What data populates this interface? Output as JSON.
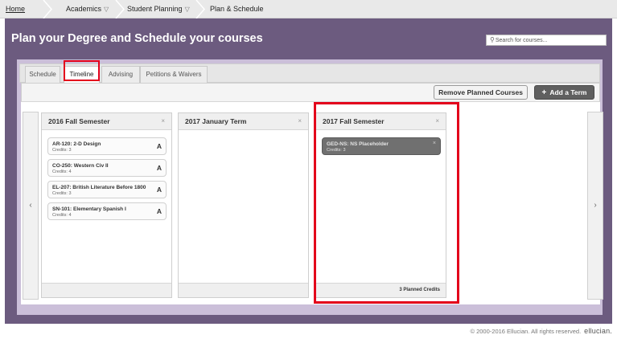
{
  "breadcrumb": {
    "home": "Home",
    "academics": "Academics",
    "student_planning": "Student Planning",
    "current": "Plan & Schedule"
  },
  "header": {
    "title": "Plan your Degree and Schedule your courses",
    "search_placeholder": "Search for courses..."
  },
  "tabs": [
    {
      "label": "Schedule"
    },
    {
      "label": "Timeline"
    },
    {
      "label": "Advising"
    },
    {
      "label": "Petitions & Waivers"
    }
  ],
  "toolbar": {
    "remove_label": "Remove Planned Courses",
    "add_label": "Add a Term"
  },
  "terms": [
    {
      "title": "2016 Fall Semester",
      "courses": [
        {
          "name": "AR-120: 2-D Design",
          "credits": "Credits: 3",
          "grade": "A"
        },
        {
          "name": "CO-250: Western Civ II",
          "credits": "Credits: 4",
          "grade": "A"
        },
        {
          "name": "EL-207: British Literature Before 1800",
          "credits": "Credits: 3",
          "grade": "A"
        },
        {
          "name": "SN-101: Elementary Spanish I",
          "credits": "Credits: 4",
          "grade": "A"
        }
      ],
      "footer": ""
    },
    {
      "title": "2017 January Term",
      "courses": [],
      "footer": ""
    },
    {
      "title": "2017 Fall Semester",
      "courses": [
        {
          "name": "GED-NS: NS Placeholder",
          "credits": "Credits: 3"
        }
      ],
      "footer": "3 Planned Credits"
    }
  ],
  "footer": {
    "copyright": "© 2000-2016 Ellucian. All rights reserved.",
    "brand": "ellucian."
  },
  "colors": {
    "banner": "#6c5b7f",
    "frame": "#cbbfd9",
    "highlight": "#e3001b",
    "add_button": "#5f5f5f",
    "planned_course": "#707070"
  }
}
